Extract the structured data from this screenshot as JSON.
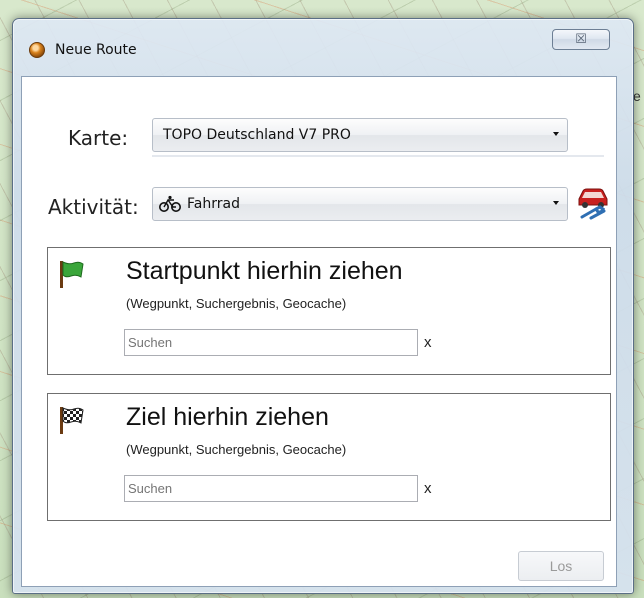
{
  "window": {
    "title": "Neue Route",
    "close_glyph": "☒"
  },
  "form": {
    "map_label": "Karte:",
    "map_value": "TOPO Deutschland V7 PRO",
    "activity_label": "Aktivität:",
    "activity_value": "Fahrrad",
    "activity_icon": "bicycle-icon",
    "settings_icon": "car-wrench-settings-icon"
  },
  "start": {
    "heading": "Startpunkt hierhin ziehen",
    "hint": "(Wegpunkt, Suchergebnis, Geocache)",
    "search_placeholder": "Suchen",
    "clear_label": "x",
    "icon": "green-flag-icon"
  },
  "destination": {
    "heading": "Ziel hierhin ziehen",
    "hint": "(Wegpunkt, Suchergebnis, Geocache)",
    "search_placeholder": "Suchen",
    "clear_label": "x",
    "icon": "checkered-flag-icon"
  },
  "actions": {
    "go_label": "Los"
  },
  "background": {
    "map_edge_text": "e"
  },
  "colors": {
    "start_flag": "#3aa63a",
    "finish_flag": "#222222",
    "car": "#c8201e",
    "wrench": "#2f6fb3"
  }
}
